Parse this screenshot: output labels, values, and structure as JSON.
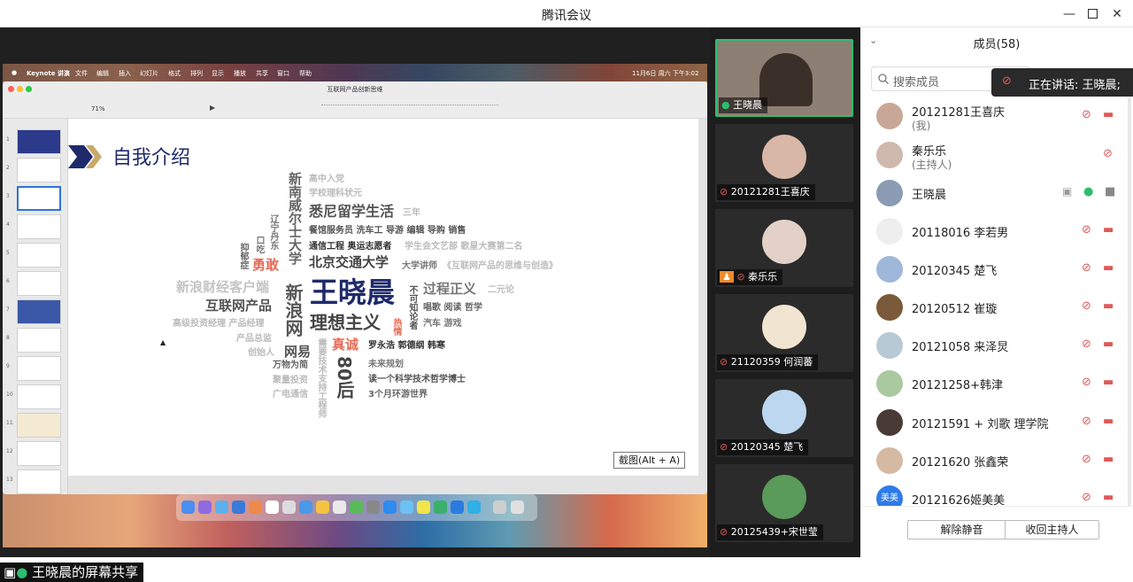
{
  "window": {
    "title": "腾讯会议"
  },
  "share": {
    "label": "王晓晨的屏幕共享",
    "screenshot_hint": "截图(Alt + A)",
    "mac_menubar": [
      "Keynote 讲演",
      "文件",
      "编辑",
      "插入",
      "幻灯片",
      "格式",
      "排列",
      "显示",
      "播放",
      "共享",
      "窗口",
      "帮助"
    ],
    "mac_clock": "11月6日 周六 下午3:02",
    "keynote": {
      "doc_title": "互联网产品创新思维",
      "zoom": "71%",
      "slide_numbers": [
        "1",
        "2",
        "3",
        "4",
        "5",
        "6",
        "7",
        "8",
        "9",
        "10",
        "11",
        "12",
        "13"
      ],
      "slide_title": "自我介绍",
      "words": {
        "name": "王晓晨",
        "idealism": "理想主义",
        "bjtu": "北京交通大学",
        "sydney_study": "悉尼留学生活",
        "three_years": "三年",
        "senior_member": "高中入党",
        "school_science": "学校理科状元",
        "unsw": "新南威尔士大学",
        "liaoning": "辽宁丹东",
        "stutter": "口吃",
        "depression": "抑郁症",
        "brave": "勇敢",
        "jobs": "餐馆服务员  洗车工  导游  编辑  导购  销售",
        "engineer": "通信工程  奥运志愿者",
        "art_troupe": "学生会文艺部  歌星大赛第二名",
        "lecturer": "大学讲师",
        "course": "《互联网产品的思维与创造》",
        "sina_client": "新浪财经客户端",
        "internet_pm": "互联网产品",
        "hi_investor": "高级投资经理  产品经理",
        "product_director": "产品总监",
        "founder": "创始人",
        "sina": "新浪网",
        "netease": "网易",
        "sincere": "真诚",
        "process_justice": "过程正义",
        "dualism": "二元论",
        "agnostic": "不可知论者",
        "passion": "热情",
        "singing": "唱歌  阅读  哲学",
        "cars": "汽车  游戏",
        "authors": "罗永浩  郭德纲  韩寒",
        "post80": "80后",
        "tech_support": "需要技术支持工程师",
        "wanwu": "万物为简",
        "jubao": "聚量投资",
        "guangdian": "广电通信",
        "future_plan": "未来规划",
        "phd": "读一个科学技术哲学博士",
        "travel": "3个月环游世界"
      }
    }
  },
  "videos": [
    {
      "name": "王晓晨",
      "mic": "on",
      "active": true
    },
    {
      "name": "20121281王喜庆",
      "mic": "muted"
    },
    {
      "name": "秦乐乐",
      "mic": "muted",
      "host": true
    },
    {
      "name": "21120359 何润蕃",
      "mic": "muted"
    },
    {
      "name": "20120345 楚飞",
      "mic": "muted"
    },
    {
      "name": "20125439+宋世莹",
      "mic": "muted"
    }
  ],
  "members_panel": {
    "title": "成员(58)",
    "search_placeholder": "搜索成员",
    "speaking_banner": "正在讲话: 王晓晨;",
    "members": [
      {
        "name": "20121281王喜庆",
        "role": "(我)",
        "mic": "muted"
      },
      {
        "name": "秦乐乐",
        "role": "(主持人)",
        "mic": "muted"
      },
      {
        "name": "王晓晨",
        "role": "",
        "mic": "on"
      },
      {
        "name": "20118016 李若男",
        "role": "",
        "mic": "muted"
      },
      {
        "name": "20120345 楚飞",
        "role": "",
        "mic": "muted"
      },
      {
        "name": "20120512 崔璇",
        "role": "",
        "mic": "muted"
      },
      {
        "name": "20121058 来泽炅",
        "role": "",
        "mic": "muted"
      },
      {
        "name": "20121258+韩津",
        "role": "",
        "mic": "muted"
      },
      {
        "name": "20121591 + 刘歌  理学院",
        "role": "",
        "mic": "muted"
      },
      {
        "name": "20121620 张鑫荣",
        "role": "",
        "mic": "muted"
      },
      {
        "name": "20121626姬美美",
        "role": "",
        "mic": "muted",
        "avatar_text": "美美"
      }
    ],
    "unmute_all": "解除静音",
    "reclaim_host": "收回主持人"
  },
  "colors": {
    "accent_green": "#2dbd6e",
    "muted_red": "#e05a5a",
    "navy": "#1f2a6b",
    "orange_red": "#e86a55"
  }
}
